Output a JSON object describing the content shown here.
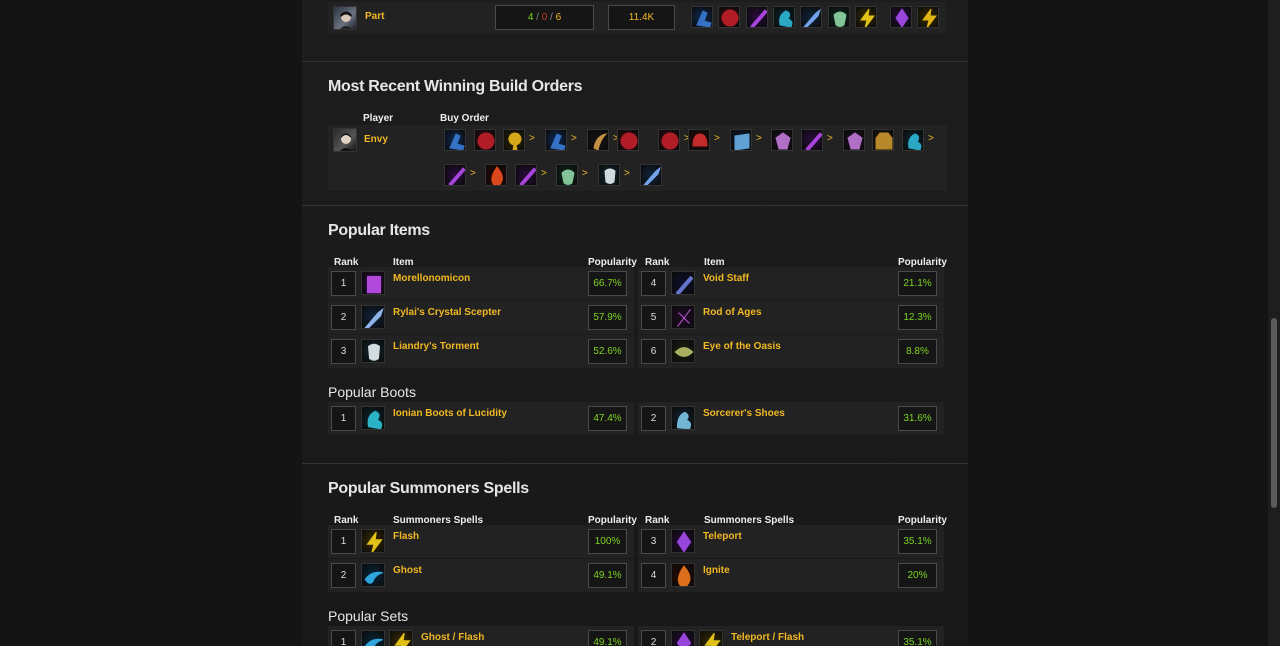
{
  "top_row": {
    "player": "Part",
    "kda": {
      "kills": "4",
      "deaths": "0",
      "assists": "6",
      "sep": " / "
    },
    "damage": "11.4K",
    "items": [
      "boots-blue-icon",
      "orb-red-icon",
      "staff-purple-icon",
      "boots-teal-icon",
      "scepter-blue-icon",
      "mask-green-icon",
      "flash-yellow-icon",
      "teleport-purple-icon",
      "flash-gold-icon"
    ]
  },
  "build_orders": {
    "title": "Most Recent Winning Build Orders",
    "col_player": "Player",
    "col_buy_order": "Buy Order",
    "player": "Envy",
    "separator": ">",
    "row1": [
      "boots-blue-icon",
      "orb-red-icon",
      "lamp-yellow-icon",
      "boots-blue-icon",
      "dark-blade-icon",
      "orb-red-icon",
      "orb-red-icon",
      "red-helm-icon",
      "book-blue-icon",
      "dark-purple-icon",
      "staff-purple-icon",
      "dark-purple-icon",
      "chest-gold-icon",
      "boots-teal-icon"
    ],
    "row2": [
      "staff-purple-icon",
      "red-fire-icon",
      "staff-purple-icon",
      "mask-green-icon",
      "face-white-icon",
      "scepter-blue-icon"
    ]
  },
  "popular_items": {
    "title": "Popular Items",
    "col_rank": "Rank",
    "col_item": "Item",
    "col_popularity": "Popularity",
    "left": [
      {
        "rank": "1",
        "name": "Morellonomicon",
        "popularity": "66.7%",
        "icon": "morellonomicon-icon"
      },
      {
        "rank": "2",
        "name": "Rylai's Crystal Scepter",
        "popularity": "57.9%",
        "icon": "rylais-scepter-icon"
      },
      {
        "rank": "3",
        "name": "Liandry's Torment",
        "popularity": "52.6%",
        "icon": "liandrys-torment-icon"
      }
    ],
    "right": [
      {
        "rank": "4",
        "name": "Void Staff",
        "popularity": "21.1%",
        "icon": "void-staff-icon"
      },
      {
        "rank": "5",
        "name": "Rod of Ages",
        "popularity": "12.3%",
        "icon": "rod-of-ages-icon"
      },
      {
        "rank": "6",
        "name": "Eye of the Oasis",
        "popularity": "8.8%",
        "icon": "eye-of-oasis-icon"
      }
    ]
  },
  "popular_boots": {
    "title": "Popular Boots",
    "left": {
      "rank": "1",
      "name": "Ionian Boots of Lucidity",
      "popularity": "47.4%",
      "icon": "ionian-boots-icon"
    },
    "right": {
      "rank": "2",
      "name": "Sorcerer's Shoes",
      "popularity": "31.6%",
      "icon": "sorcerers-shoes-icon"
    }
  },
  "summoner_spells": {
    "title": "Popular Summoners Spells",
    "col_rank": "Rank",
    "col_spell": "Summoners Spells",
    "col_popularity": "Popularity",
    "left": [
      {
        "rank": "1",
        "name": "Flash",
        "popularity": "100%",
        "icon": "flash-icon"
      },
      {
        "rank": "2",
        "name": "Ghost",
        "popularity": "49.1%",
        "icon": "ghost-icon"
      }
    ],
    "right": [
      {
        "rank": "3",
        "name": "Teleport",
        "popularity": "35.1%",
        "icon": "teleport-icon"
      },
      {
        "rank": "4",
        "name": "Ignite",
        "popularity": "20%",
        "icon": "ignite-icon"
      }
    ]
  },
  "popular_sets": {
    "title": "Popular Sets",
    "left": {
      "rank": "1",
      "name": "Ghost / Flash",
      "popularity": "49.1%"
    },
    "right": {
      "rank": "2",
      "name": "Teleport / Flash",
      "popularity": "35.1%"
    }
  },
  "colors": {
    "accent_gold": "#f0b823",
    "positive_green": "#7ed321",
    "deaths_red": "#c0392b"
  }
}
